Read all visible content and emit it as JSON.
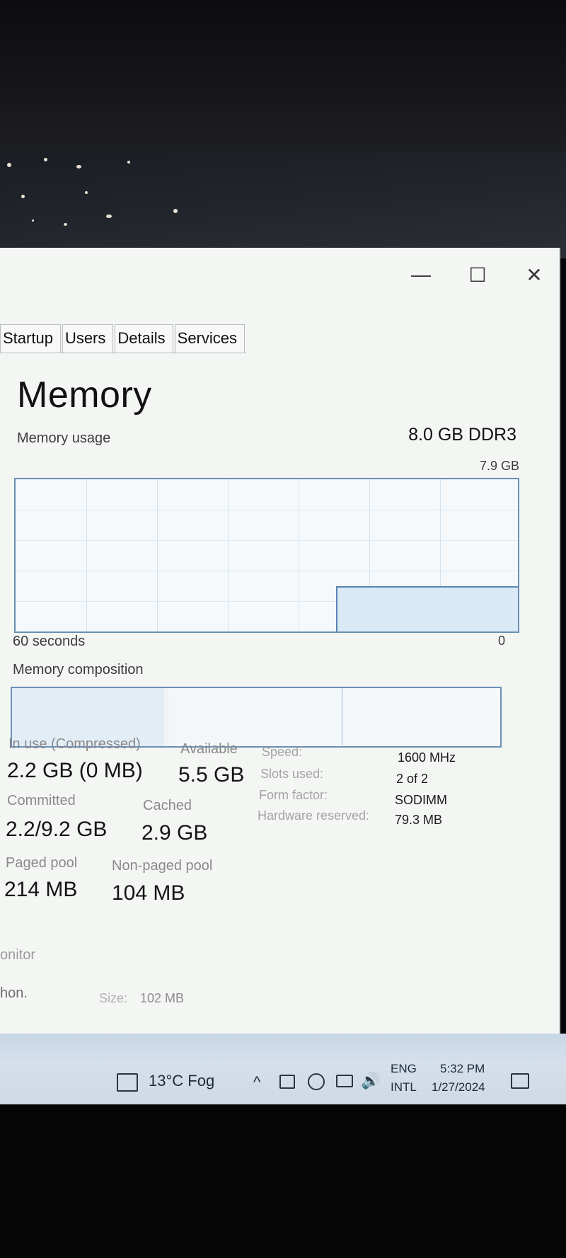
{
  "window": {
    "minimize_symbol": "—",
    "maximize_symbol": "☐",
    "close_symbol": "✕"
  },
  "tabs": [
    {
      "label": "Startup"
    },
    {
      "label": "Users"
    },
    {
      "label": "Details"
    },
    {
      "label": "Services"
    }
  ],
  "memory": {
    "title": "Memory",
    "spec": "8.0 GB DDR3",
    "usage_label": "Memory usage",
    "usage_max": "7.9 GB",
    "time_span": "60 seconds",
    "axis_min": "0",
    "composition_label": "Memory composition",
    "usage_level_fraction": 0.29
  },
  "stats": {
    "in_use_label": "In use (Compressed)",
    "in_use_value": "2.2 GB (0 MB)",
    "available_label": "Available",
    "available_value": "5.5 GB",
    "committed_label": "Committed",
    "committed_value": "2.2/9.2 GB",
    "cached_label": "Cached",
    "cached_value": "2.9 GB",
    "paged_pool_label": "Paged pool",
    "paged_pool_value": "214 MB",
    "nonpaged_pool_label": "Non-paged pool",
    "nonpaged_pool_value": "104 MB"
  },
  "specs": {
    "speed_label": "Speed:",
    "speed_value": "1600 MHz",
    "slots_label": "Slots used:",
    "slots_value": "2 of 2",
    "form_label": "Form factor:",
    "form_value": "SODIMM",
    "hw_label": "Hardware reserved:",
    "hw_value": "79.3 MB"
  },
  "footer": {
    "monitor_partial": "onitor",
    "partial_left": "hon.",
    "size_label": "Size:",
    "size_value": "102 MB"
  },
  "taskbar": {
    "weather": "13°C  Fog",
    "lang_top": "ENG",
    "lang_bottom": "INTL",
    "time": "5:32 PM",
    "date": "1/27/2024",
    "chevron_symbol": "^"
  },
  "colors": {
    "graph_border": "#6b8fb4",
    "usage_fill": "#d9e9f6",
    "taskbar": "#cfd9e4"
  }
}
